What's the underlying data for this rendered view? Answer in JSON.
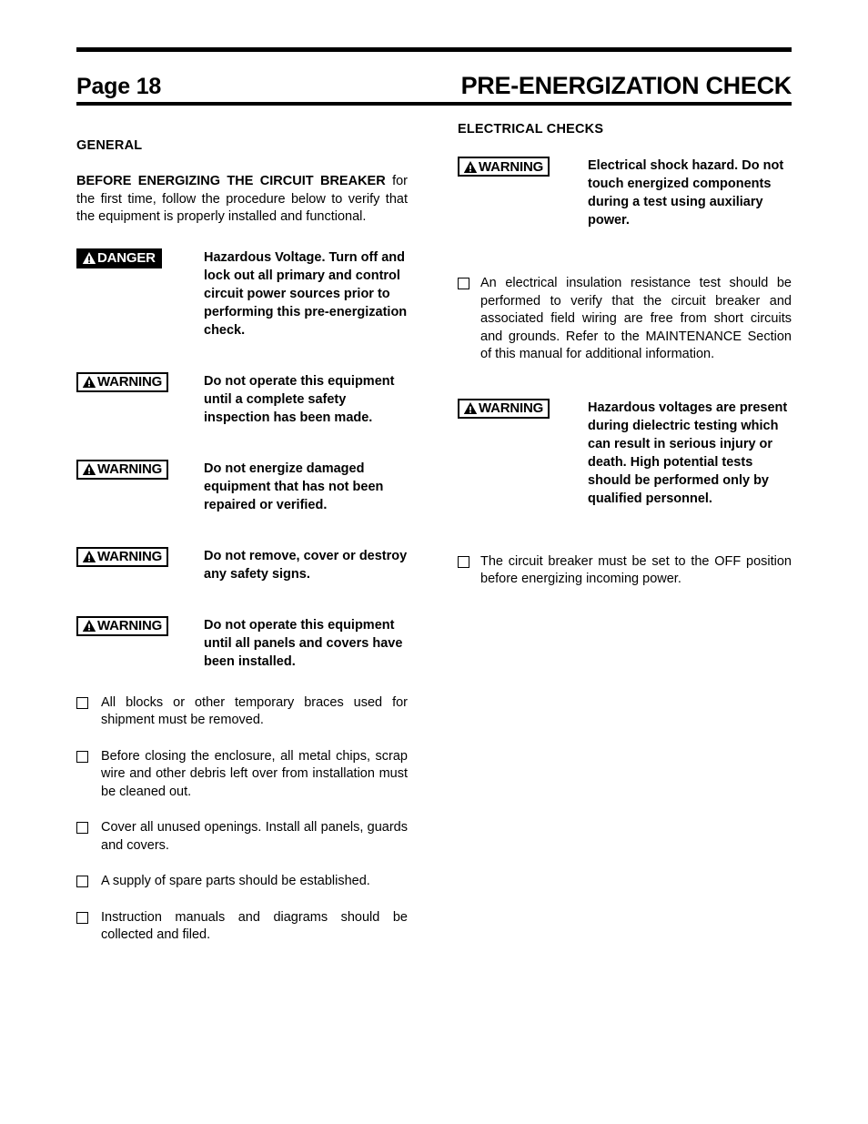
{
  "header": {
    "page_label": "Page 18",
    "title": "PRE-ENERGIZATION CHECK"
  },
  "left_column": {
    "section_heading": "GENERAL",
    "intro": {
      "bold_lead": "BEFORE ENERGIZING THE CIRCUIT BREAKER",
      "rest": " for the first time, follow the procedure below to verify that the equipment is properly installed and functional."
    },
    "alerts": [
      {
        "type": "danger",
        "badge_label": "DANGER",
        "text": "Hazardous Voltage. Turn off and lock out all primary and control circuit power sources prior to performing this pre-energization check."
      },
      {
        "type": "warning",
        "badge_label": "WARNING",
        "text": "Do not operate this equipment until a complete safety inspection has been made."
      },
      {
        "type": "warning",
        "badge_label": "WARNING",
        "text": "Do not energize damaged equipment that has not been repaired or verified."
      },
      {
        "type": "warning",
        "badge_label": "WARNING",
        "text": "Do not remove, cover or destroy any safety signs."
      },
      {
        "type": "warning",
        "badge_label": "WARNING",
        "text": "Do not operate this equipment until all panels and covers have been installed."
      }
    ],
    "checklist": [
      "All blocks or other temporary braces used for shipment must be removed.",
      "Before closing the enclosure, all metal chips, scrap wire and other debris left over from installation must be cleaned out.",
      "Cover all unused openings. Install all panels, guards and covers.",
      "A supply of spare parts should be established.",
      "Instruction manuals and diagrams should be collected and filed."
    ]
  },
  "right_column": {
    "section_heading": "ELECTRICAL CHECKS",
    "alert_1": {
      "type": "warning",
      "badge_label": "WARNING",
      "text": "Electrical shock hazard. Do not touch energized components during a test using auxiliary power."
    },
    "checklist_1": [
      "An electrical insulation resistance test should be performed to verify that the circuit breaker and associated field wiring are free from short circuits and grounds. Refer to the MAINTENANCE Section of this manual for additional information."
    ],
    "alert_2": {
      "type": "warning",
      "badge_label": "WARNING",
      "text": "Hazardous voltages are present during dielectric testing which can result in serious injury or death. High potential tests should be performed only by qualified personnel."
    },
    "checklist_2": [
      "The circuit breaker must be set to the OFF position before energizing incoming power."
    ]
  },
  "colors": {
    "ink": "#000000",
    "paper": "#ffffff",
    "danger_badge_bg": "#000000",
    "danger_badge_fg": "#ffffff",
    "warning_badge_bg": "#ffffff",
    "warning_badge_fg": "#000000"
  }
}
